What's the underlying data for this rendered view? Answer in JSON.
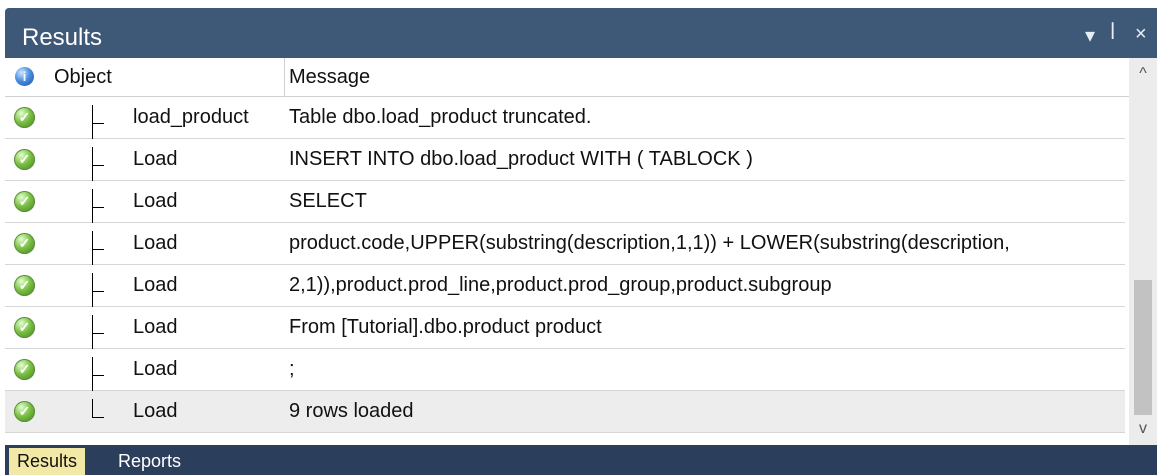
{
  "panel": {
    "title": "Results",
    "controls": {
      "dropdown": "▾",
      "pin": "ᵖ",
      "close": "×"
    }
  },
  "grid": {
    "columns": [
      "Object",
      "Message"
    ],
    "rows": [
      {
        "object": "load_product",
        "message": "Table dbo.load_product truncated.",
        "status": "ok"
      },
      {
        "object": "Load",
        "message": "INSERT INTO dbo.load_product  WITH ( TABLOCK )",
        "status": "ok"
      },
      {
        "object": "Load",
        "message": "SELECT",
        "status": "ok"
      },
      {
        "object": "Load",
        "message": "product.code,UPPER(substring(description,1,1)) + LOWER(substring(description,",
        "status": "ok"
      },
      {
        "object": "Load",
        "message": "2,1)),product.prod_line,product.prod_group,product.subgroup",
        "status": "ok"
      },
      {
        "object": "Load",
        "message": "From [Tutorial].dbo.product product",
        "status": "ok"
      },
      {
        "object": "Load",
        "message": ";",
        "status": "ok"
      },
      {
        "object": "Load",
        "message": "9 rows loaded",
        "status": "ok",
        "selected": true
      }
    ]
  },
  "tabs": [
    {
      "label": "Results",
      "active": true
    },
    {
      "label": "Reports",
      "active": false
    }
  ],
  "colors": {
    "title_bar": "#3e5878",
    "tab_bar": "#2b3f5c",
    "active_tab": "#f3e9a6"
  }
}
